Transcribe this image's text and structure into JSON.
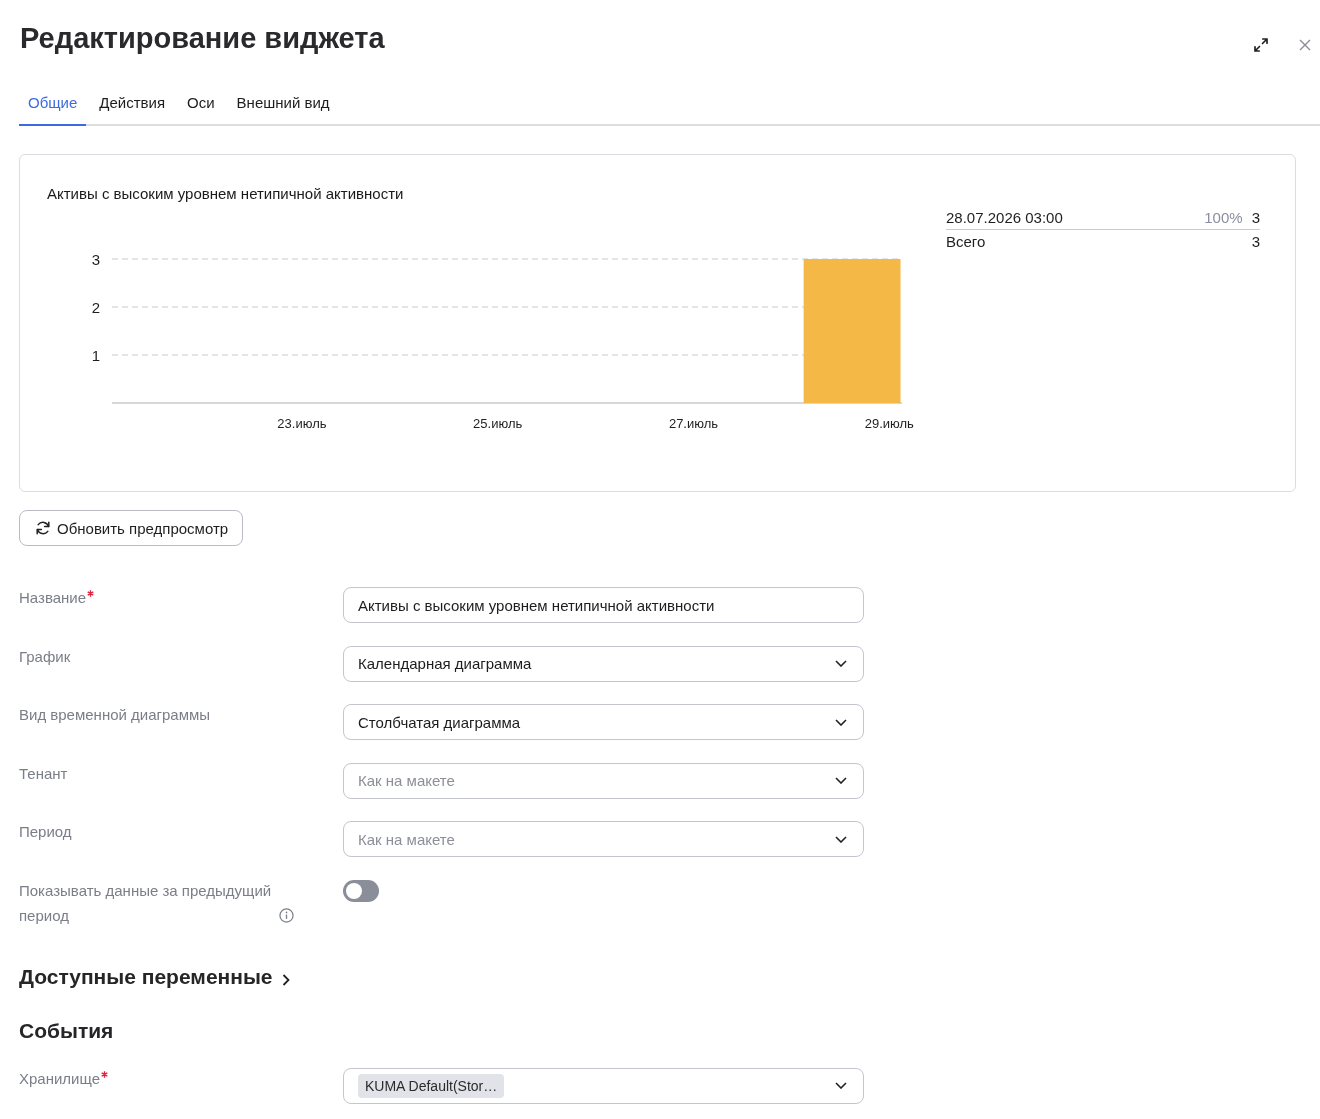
{
  "window": {
    "title": "Редактирование виджета"
  },
  "tabs": [
    {
      "label": "Общие",
      "selected": true
    },
    {
      "label": "Действия",
      "selected": false
    },
    {
      "label": "Оси",
      "selected": false
    },
    {
      "label": "Внешний вид",
      "selected": false
    }
  ],
  "preview": {
    "chart_data": {
      "type": "bar",
      "title": "Активы с высоким уровнем нетипичной активности",
      "x": [
        28.62
      ],
      "values": [
        3
      ],
      "xlim": [
        21.06,
        29.13
      ],
      "ylim": [
        0,
        3
      ],
      "xticks": [
        {
          "value": 23,
          "label": "23.июль"
        },
        {
          "value": 25,
          "label": "25.июль"
        },
        {
          "value": 27,
          "label": "27.июль"
        },
        {
          "value": 29,
          "label": "29.июль"
        }
      ],
      "yticks": [
        1,
        2,
        3
      ]
    },
    "legend": {
      "rows": [
        {
          "label": "28.07.2026 03:00",
          "percent": "100%",
          "value": "3"
        }
      ],
      "total": {
        "label": "Всего",
        "value": "3"
      }
    }
  },
  "refresh_button": {
    "label": "Обновить предпросмотр"
  },
  "fields": [
    {
      "kind": "text",
      "label": "Название",
      "required": true,
      "info": false,
      "value": "Активы с высоким уровнем нетипичной активности"
    },
    {
      "kind": "select",
      "label": "График",
      "required": false,
      "info": false,
      "value": "Календарная диаграмма"
    },
    {
      "kind": "select",
      "label": "Вид временной диаграммы",
      "required": false,
      "info": false,
      "value": "Столбчатая диаграмма"
    },
    {
      "kind": "select",
      "label": "Тенант",
      "required": false,
      "info": false,
      "placeholder": "Как на макете"
    },
    {
      "kind": "select",
      "label": "Период",
      "required": false,
      "info": false,
      "placeholder": "Как на макете"
    },
    {
      "kind": "toggle",
      "label": "Показывать данные за предыдущий период",
      "required": false,
      "info": true,
      "on": false
    }
  ],
  "variables_section": {
    "title": "Доступные переменные",
    "expanded": false
  },
  "events_section": {
    "title": "События",
    "fields": [
      {
        "kind": "tags",
        "label": "Хранилище",
        "required": true,
        "info": false,
        "tags": [
          "KUMA Default(Stor…"
        ]
      }
    ]
  }
}
